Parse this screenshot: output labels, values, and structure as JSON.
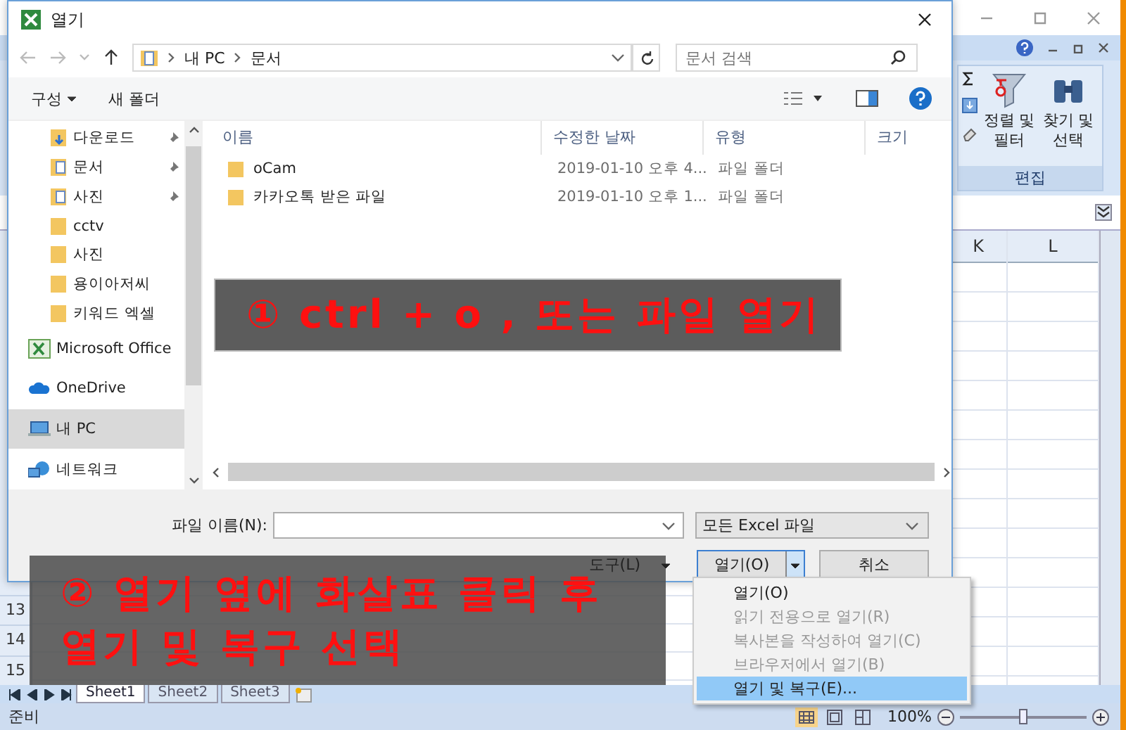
{
  "excel": {
    "ribbon": {
      "buttons": [
        {
          "label": "정렬 및 필터",
          "kind": "sort"
        },
        {
          "label": "찾기 및 선택",
          "kind": "find"
        }
      ],
      "group": "편집"
    },
    "columns": [
      "K",
      "L"
    ],
    "rows": [
      "13",
      "14",
      "15"
    ],
    "sheets": [
      {
        "label": "Sheet1",
        "selected": true
      },
      {
        "label": "Sheet2",
        "selected": false
      },
      {
        "label": "Sheet3",
        "selected": false
      }
    ],
    "status": "준비",
    "zoom": "100%",
    "zoom_slider": {
      "level": 0.5
    }
  },
  "dialog": {
    "title": "열기",
    "breadcrumb": [
      "내 PC",
      "문서"
    ],
    "search": {
      "placeholder": "문서 검색"
    },
    "toolbar": [
      "구성",
      "새 폴더"
    ],
    "sidebar": [
      {
        "label": "다운로드",
        "kind": "download",
        "pinned": true,
        "selected": false
      },
      {
        "label": "문서",
        "kind": "docs",
        "pinned": true,
        "selected": false
      },
      {
        "label": "사진",
        "kind": "pictures",
        "pinned": true,
        "selected": false
      },
      {
        "label": "cctv",
        "kind": "folder",
        "pinned": false,
        "selected": false
      },
      {
        "label": "사진",
        "kind": "folder",
        "pinned": false,
        "selected": false
      },
      {
        "label": "용이아저씨",
        "kind": "folder",
        "pinned": false,
        "selected": false
      },
      {
        "label": "키워드 엑셀",
        "kind": "folder",
        "pinned": false,
        "selected": false
      },
      {
        "label": "Microsoft Office",
        "kind": "excel",
        "pinned": false,
        "selected": false
      },
      {
        "label": "OneDrive",
        "kind": "cloud",
        "pinned": false,
        "selected": false
      },
      {
        "label": "내 PC",
        "kind": "pc",
        "pinned": false,
        "selected": true
      },
      {
        "label": "네트워크",
        "kind": "network",
        "pinned": false,
        "selected": false
      }
    ],
    "columns": [
      "이름",
      "수정한 날짜",
      "유형",
      "크기"
    ],
    "files": [
      {
        "name": "oCam",
        "date": "2019-01-10 오후 4...",
        "type": "파일 폴더"
      },
      {
        "name": "카카오톡 받은 파일",
        "date": "2019-01-10 오후 1...",
        "type": "파일 폴더"
      }
    ],
    "filename": {
      "label": "파일 이름(N):"
    },
    "filter": "모든 Excel 파일",
    "tools": "도구(L)",
    "open": "열기(O)",
    "cancel": "취소",
    "open_menu": [
      {
        "label": "열기(O)",
        "disabled": false,
        "selected": false
      },
      {
        "label": "읽기 전용으로 열기(R)",
        "disabled": true,
        "selected": false
      },
      {
        "label": "복사본을 작성하여 열기(C)",
        "disabled": true,
        "selected": false
      },
      {
        "label": "브라우저에서 열기(B)",
        "disabled": true,
        "selected": false
      },
      {
        "label": "열기 및 복구(E)...",
        "disabled": false,
        "selected": true
      }
    ]
  },
  "annotations": [
    {
      "lines": [
        "① ctrl + o , 또는 파일 열기"
      ]
    },
    {
      "lines": [
        "② 열기 옆에 화살표 클릭 후",
        "열기 및 복구 선택"
      ]
    }
  ]
}
